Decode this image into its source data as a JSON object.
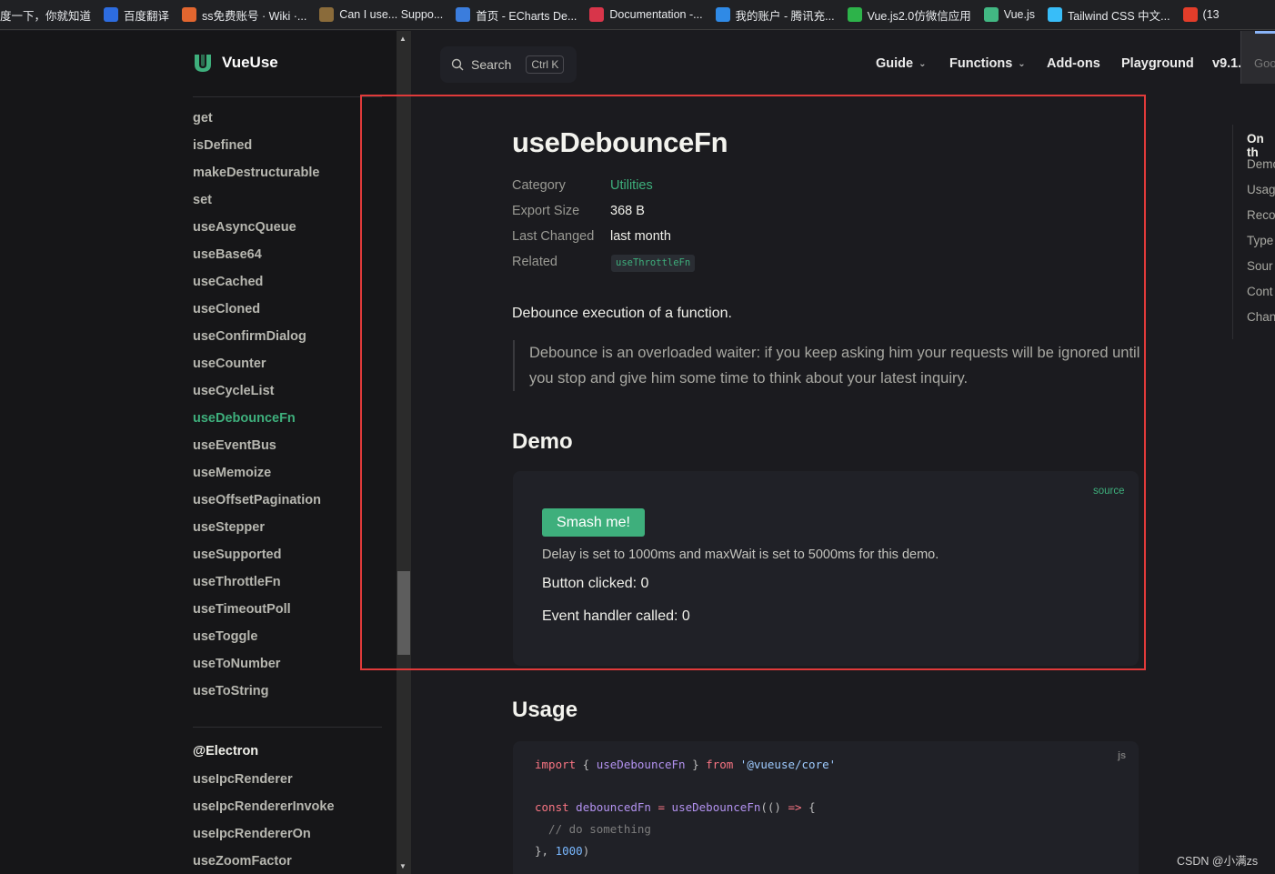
{
  "bookmarks": [
    {
      "label": "度一下，你就知道",
      "icon": "none",
      "color": "#202124"
    },
    {
      "label": "百度翻译",
      "icon": "translate-icon",
      "color": "#2d6cdf"
    },
    {
      "label": "ss免费账号 · Wiki ·...",
      "icon": "fox-icon",
      "color": "#e2662f"
    },
    {
      "label": "Can I use... Suppo...",
      "icon": "caniuse-icon",
      "color": "#8a6b3a"
    },
    {
      "label": "首页 - ECharts De...",
      "icon": "echarts-icon",
      "color": "#3b7ddd"
    },
    {
      "label": "Documentation -...",
      "icon": "doc-icon",
      "color": "#d8354a"
    },
    {
      "label": "我的账户 - 腾讯充...",
      "icon": "tencent-icon",
      "color": "#2f8ae6"
    },
    {
      "label": "Vue.js2.0仿微信应用",
      "icon": "wechat-icon",
      "color": "#2db34a"
    },
    {
      "label": "Vue.js",
      "icon": "vue-icon",
      "color": "#42b883"
    },
    {
      "label": "Tailwind CSS 中文...",
      "icon": "tailwind-icon",
      "color": "#38bdf8"
    },
    {
      "label": "(13",
      "icon": "csdn-icon",
      "color": "#e33d2a"
    }
  ],
  "logo": {
    "text": "VueUse",
    "accent": "#3eaf7c"
  },
  "sidebar": {
    "items": [
      "get",
      "isDefined",
      "makeDestructurable",
      "set",
      "useAsyncQueue",
      "useBase64",
      "useCached",
      "useCloned",
      "useConfirmDialog",
      "useCounter",
      "useCycleList",
      "useDebounceFn",
      "useEventBus",
      "useMemoize",
      "useOffsetPagination",
      "useStepper",
      "useSupported",
      "useThrottleFn",
      "useTimeoutPoll",
      "useToggle",
      "useToNumber",
      "useToString"
    ],
    "active": "useDebounceFn",
    "group_title": "@Electron",
    "group_items": [
      "useIpcRenderer",
      "useIpcRendererInvoke",
      "useIpcRendererOn",
      "useZoomFactor"
    ]
  },
  "search": {
    "label": "Search",
    "shortcut": "Ctrl K"
  },
  "nav": {
    "guide": "Guide",
    "functions": "Functions",
    "addons": "Add-ons",
    "playground": "Playground",
    "version": "v9.1."
  },
  "overlay": {
    "text": "Goo"
  },
  "toc": {
    "title": "On th",
    "items": [
      "Demo",
      "Usag",
      "Reco",
      "Type",
      "Sour",
      "Cont",
      "Chan"
    ]
  },
  "page": {
    "title": "useDebounceFn",
    "meta": [
      {
        "label": "Category",
        "value": "Utilities"
      },
      {
        "label": "Export Size",
        "value": "368 B"
      },
      {
        "label": "Last Changed",
        "value": "last month"
      },
      {
        "label": "Related",
        "value": "useThrottleFn"
      }
    ],
    "description": "Debounce execution of a function.",
    "quote": "Debounce is an overloaded waiter: if you keep asking him your requests will be ignored until you stop and give him some time to think about your latest inquiry.",
    "demo_heading": "Demo",
    "usage_heading": "Usage"
  },
  "demo": {
    "source_label": "source",
    "button_label": "Smash me!",
    "note": "Delay is set to 1000ms and maxWait is set to 5000ms for this demo.",
    "clicked_label": "Button clicked: 0",
    "handler_label": "Event handler called: 0"
  },
  "code": {
    "lang": "js",
    "line1": {
      "kw_import": "import",
      "brace_open": " { ",
      "fn_name": "useDebounceFn",
      "brace_close": " } ",
      "kw_from": "from",
      "module": " '@vueuse/core'"
    },
    "line2": {
      "kw_const": "const",
      "var_name": " debouncedFn ",
      "eq": "=",
      "call": " useDebounceFn",
      "args": "(() ",
      "arrow": "=>",
      "open": " {"
    },
    "line3": {
      "comment": "  // do something"
    },
    "line4": {
      "close": "}, ",
      "num": "1000",
      "end": ")"
    }
  },
  "watermark": "CSDN @小满zs"
}
